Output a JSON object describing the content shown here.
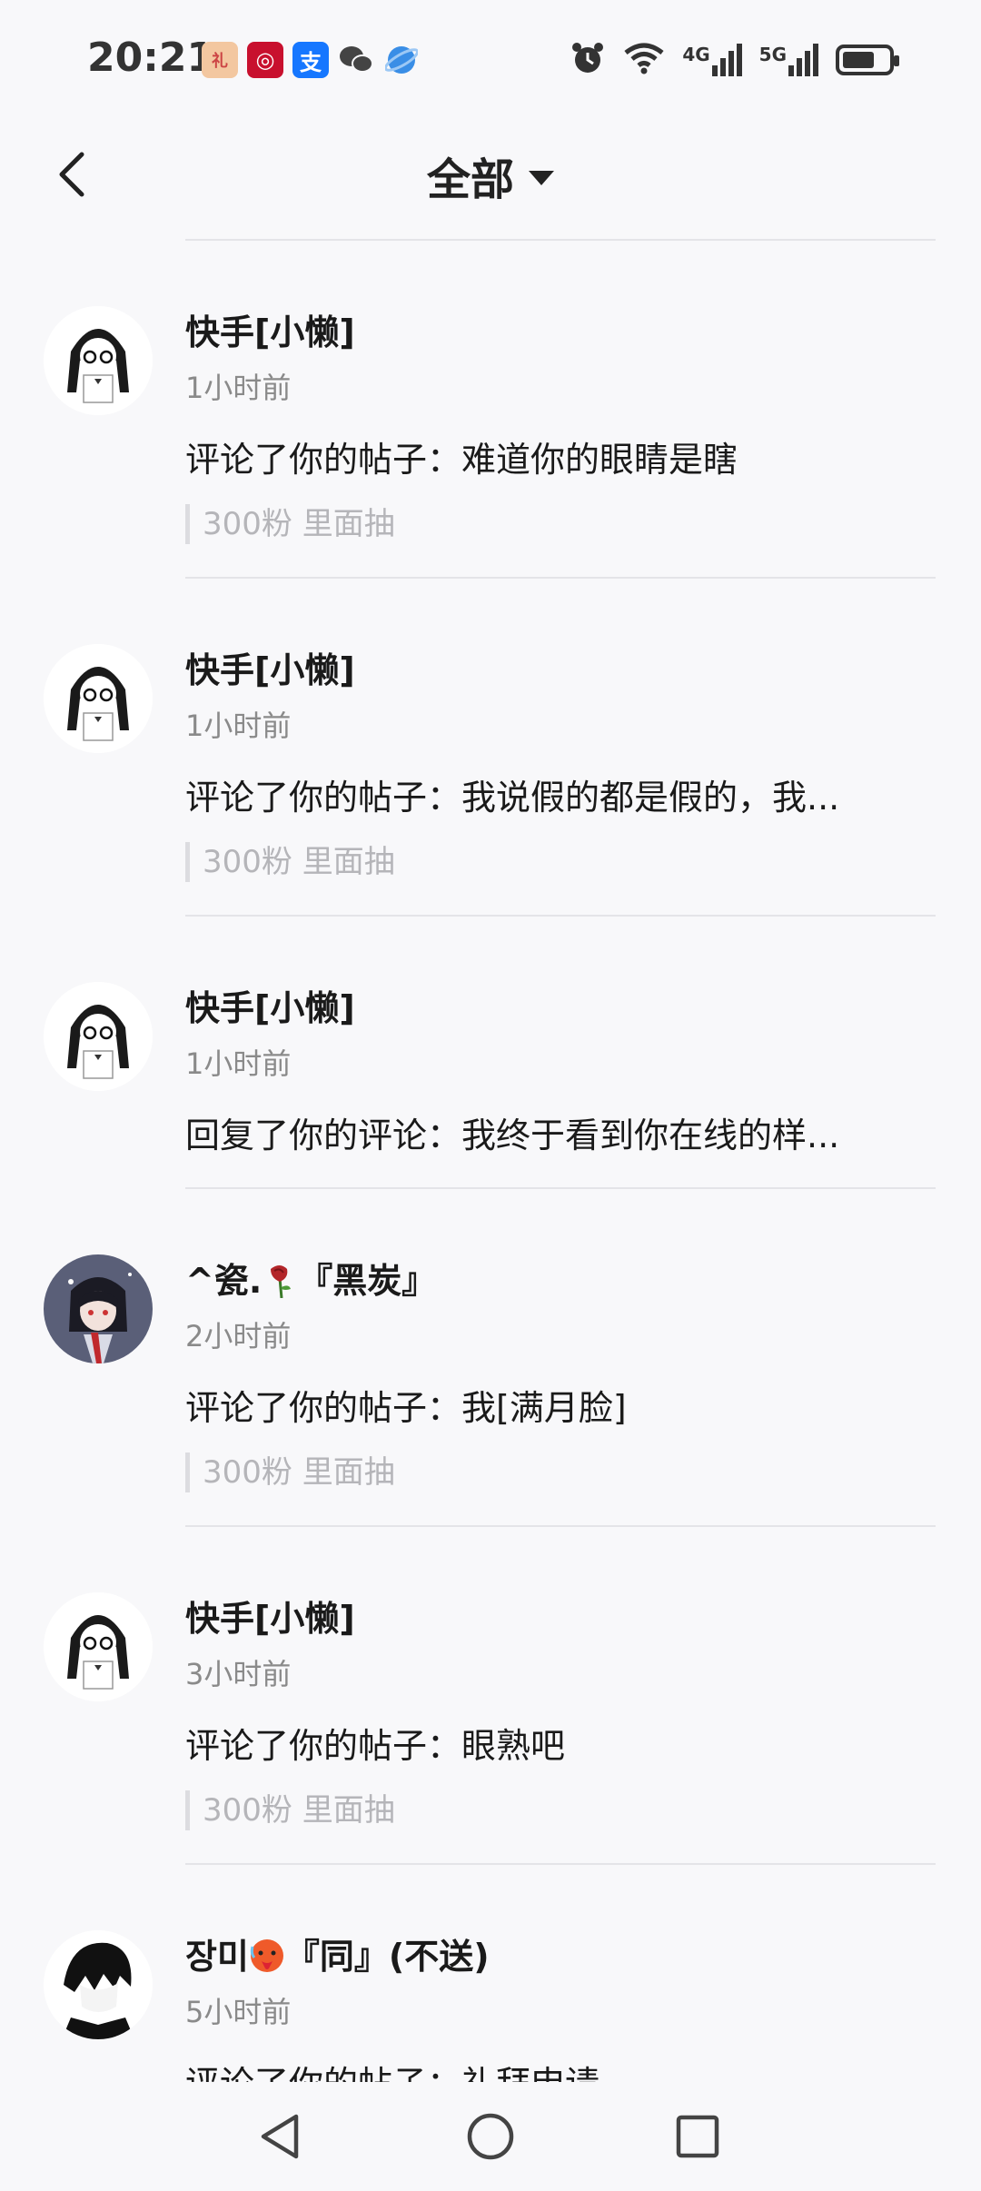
{
  "status_bar": {
    "time": "20:21",
    "app_icons": [
      "gift-app-icon",
      "bank-app-icon",
      "alipay-app-icon",
      "wechat-app-icon",
      "browser-app-icon"
    ],
    "signal_1_label": "4G",
    "signal_2_label": "5G",
    "battery_level": 0.7
  },
  "header": {
    "title": "全部"
  },
  "notifications": [
    {
      "name": "快手[小懒]",
      "time": "1小时前",
      "content": "评论了你的帖子：难道你的眼睛是瞎",
      "quote": "300粉 里面抽"
    },
    {
      "name": "快手[小懒]",
      "time": "1小时前",
      "content": "评论了你的帖子：我说假的都是假的，我...",
      "quote": "300粉 里面抽"
    },
    {
      "name": "快手[小懒]",
      "time": "1小时前",
      "content": "回复了你的评论：我终于看到你在线的样..."
    },
    {
      "name_prefix": "^瓷.",
      "name_suffix": "『黑炭』",
      "time": "2小时前",
      "content": "评论了你的帖子：我[满月脸]",
      "quote": "300粉 里面抽"
    },
    {
      "name": "快手[小懒]",
      "time": "3小时前",
      "content": "评论了你的帖子：眼熟吧",
      "quote": "300粉 里面抽"
    },
    {
      "name_prefix": "장미",
      "name_suffix": "『同』(不送)",
      "time": "5小时前",
      "content": "评论了你的帖子：礼拜申请"
    }
  ],
  "nav": {
    "icons": [
      "back-triangle-icon",
      "home-circle-icon",
      "recents-square-icon"
    ]
  },
  "colors": {
    "background": "#f8f8fa",
    "name_text": "#1a1a1a",
    "secondary_text": "#8a8a8a",
    "quote_text": "#b5b5b9"
  }
}
